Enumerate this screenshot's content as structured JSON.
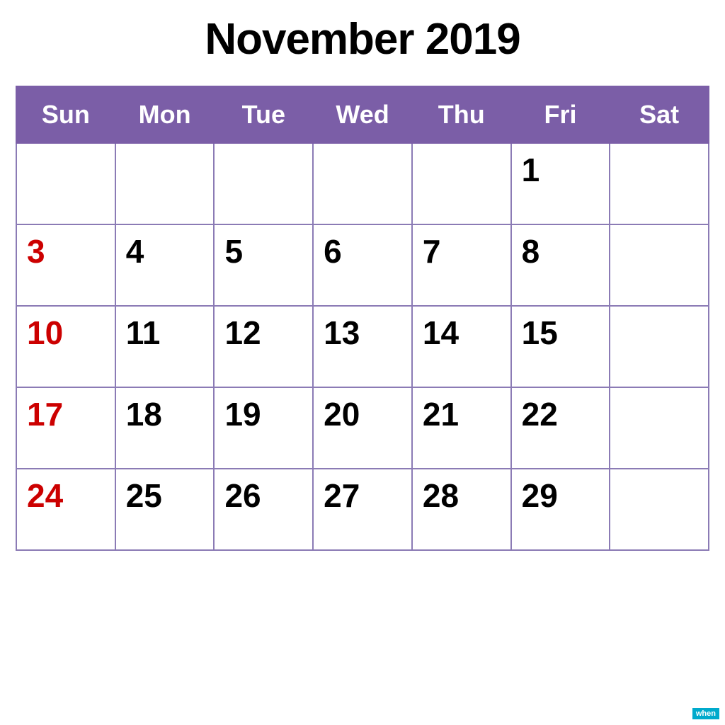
{
  "title": "November 2019",
  "header": {
    "days": [
      "Sun",
      "Mon",
      "Tue",
      "Wed",
      "Thu",
      "Fri",
      "Sat"
    ]
  },
  "weeks": [
    [
      {
        "day": "",
        "sunday": false,
        "empty": true
      },
      {
        "day": "",
        "sunday": false,
        "empty": true
      },
      {
        "day": "",
        "sunday": false,
        "empty": true
      },
      {
        "day": "",
        "sunday": false,
        "empty": true
      },
      {
        "day": "",
        "sunday": false,
        "empty": true
      },
      {
        "day": "1",
        "sunday": false,
        "empty": false
      },
      {
        "day": "",
        "sunday": false,
        "empty": true
      }
    ],
    [
      {
        "day": "3",
        "sunday": true,
        "empty": false
      },
      {
        "day": "4",
        "sunday": false,
        "empty": false
      },
      {
        "day": "5",
        "sunday": false,
        "empty": false
      },
      {
        "day": "6",
        "sunday": false,
        "empty": false
      },
      {
        "day": "7",
        "sunday": false,
        "empty": false
      },
      {
        "day": "8",
        "sunday": false,
        "empty": false
      },
      {
        "day": "",
        "sunday": false,
        "empty": true
      }
    ],
    [
      {
        "day": "10",
        "sunday": true,
        "empty": false
      },
      {
        "day": "11",
        "sunday": false,
        "empty": false
      },
      {
        "day": "12",
        "sunday": false,
        "empty": false
      },
      {
        "day": "13",
        "sunday": false,
        "empty": false
      },
      {
        "day": "14",
        "sunday": false,
        "empty": false
      },
      {
        "day": "15",
        "sunday": false,
        "empty": false
      },
      {
        "day": "",
        "sunday": false,
        "empty": true
      }
    ],
    [
      {
        "day": "17",
        "sunday": true,
        "empty": false
      },
      {
        "day": "18",
        "sunday": false,
        "empty": false
      },
      {
        "day": "19",
        "sunday": false,
        "empty": false
      },
      {
        "day": "20",
        "sunday": false,
        "empty": false
      },
      {
        "day": "21",
        "sunday": false,
        "empty": false
      },
      {
        "day": "22",
        "sunday": false,
        "empty": false
      },
      {
        "day": "",
        "sunday": false,
        "empty": true
      }
    ],
    [
      {
        "day": "24",
        "sunday": true,
        "empty": false
      },
      {
        "day": "25",
        "sunday": false,
        "empty": false
      },
      {
        "day": "26",
        "sunday": false,
        "empty": false
      },
      {
        "day": "27",
        "sunday": false,
        "empty": false
      },
      {
        "day": "28",
        "sunday": false,
        "empty": false
      },
      {
        "day": "29",
        "sunday": false,
        "empty": false
      },
      {
        "day": "",
        "sunday": false,
        "empty": true
      }
    ]
  ],
  "watermark": "when",
  "colors": {
    "header_bg": "#7b5ea7",
    "sunday_color": "#cc0000",
    "border_color": "#8b7bb5"
  }
}
